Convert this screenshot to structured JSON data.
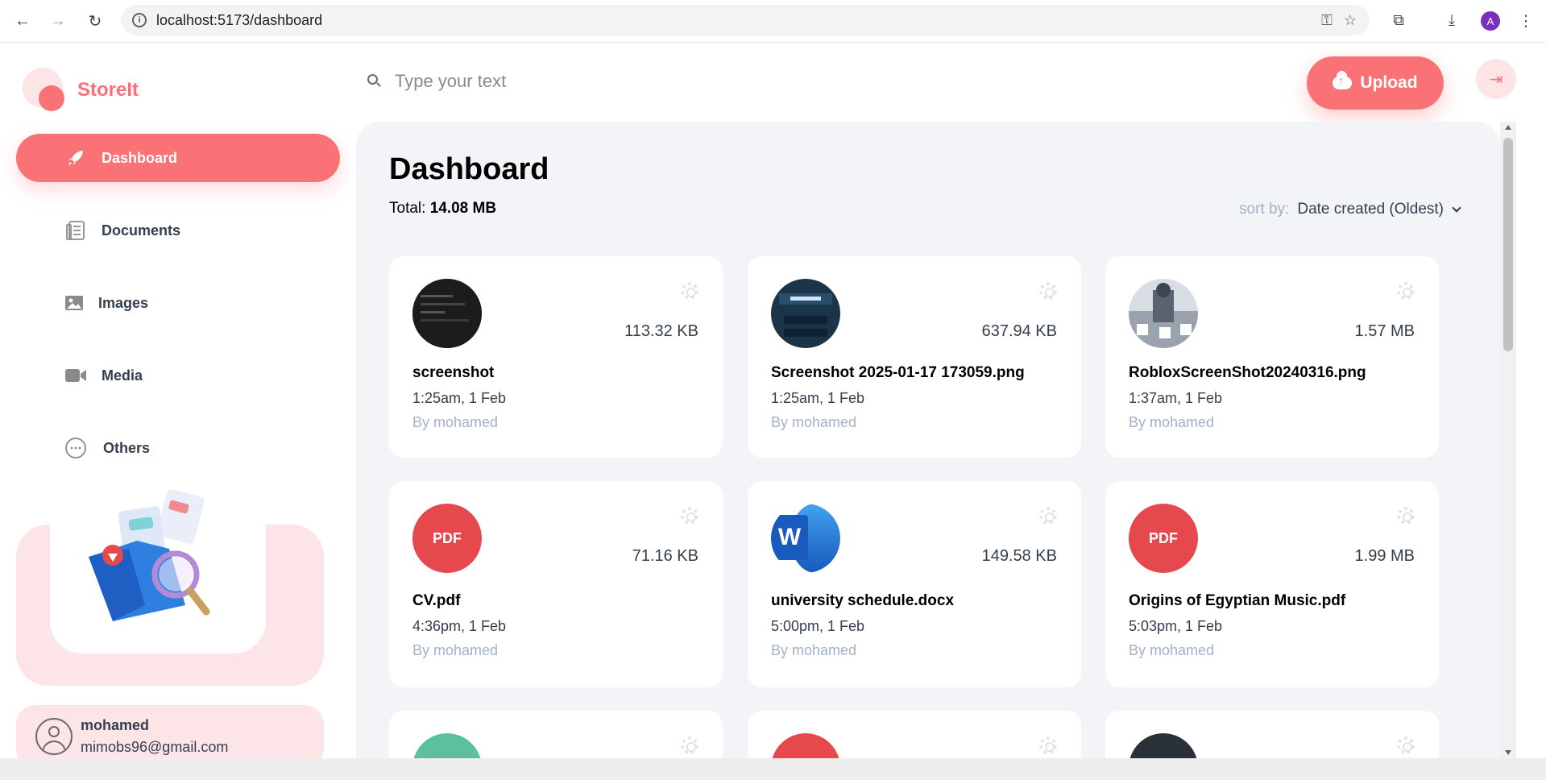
{
  "browser": {
    "url": "localhost:5173/dashboard",
    "profile_initial": "A"
  },
  "app": {
    "name": "StoreIt"
  },
  "sidebar": {
    "items": [
      {
        "label": "Dashboard",
        "icon": "rocket-icon",
        "active": true
      },
      {
        "label": "Documents",
        "icon": "document-icon",
        "active": false
      },
      {
        "label": "Images",
        "icon": "image-icon",
        "active": false
      },
      {
        "label": "Media",
        "icon": "video-icon",
        "active": false
      },
      {
        "label": "Others",
        "icon": "more-icon",
        "active": false
      }
    ]
  },
  "user": {
    "name": "mohamed",
    "email": "mimobs96@gmail.com"
  },
  "header": {
    "search_placeholder": "Type your text",
    "upload_label": "Upload"
  },
  "page": {
    "title": "Dashboard",
    "total_label": "Total:",
    "total_value": "14.08 MB",
    "sort_label": "sort by:",
    "sort_value": "Date created (Oldest)"
  },
  "files": [
    {
      "name": "screenshot",
      "size": "113.32 KB",
      "date": "1:25am, 1 Feb",
      "owner": "By mohamed",
      "type": "image"
    },
    {
      "name": "Screenshot 2025-01-17 173059.png",
      "size": "637.94 KB",
      "date": "1:25am, 1 Feb",
      "owner": "By mohamed",
      "type": "image"
    },
    {
      "name": "RobloxScreenShot20240316.png",
      "size": "1.57 MB",
      "date": "1:37am, 1 Feb",
      "owner": "By mohamed",
      "type": "image"
    },
    {
      "name": "CV.pdf",
      "size": "71.16 KB",
      "date": "4:36pm, 1 Feb",
      "owner": "By mohamed",
      "type": "pdf",
      "badge": "PDF"
    },
    {
      "name": "university schedule.docx",
      "size": "149.58 KB",
      "date": "5:00pm, 1 Feb",
      "owner": "By mohamed",
      "type": "word",
      "badge": "W"
    },
    {
      "name": "Origins of Egyptian Music.pdf",
      "size": "1.99 MB",
      "date": "5:03pm, 1 Feb",
      "owner": "By mohamed",
      "type": "pdf",
      "badge": "PDF"
    }
  ],
  "colors": {
    "brand": "#FA7275",
    "brand_light": "#fde4e6",
    "main_bg": "#F2F4F8"
  }
}
